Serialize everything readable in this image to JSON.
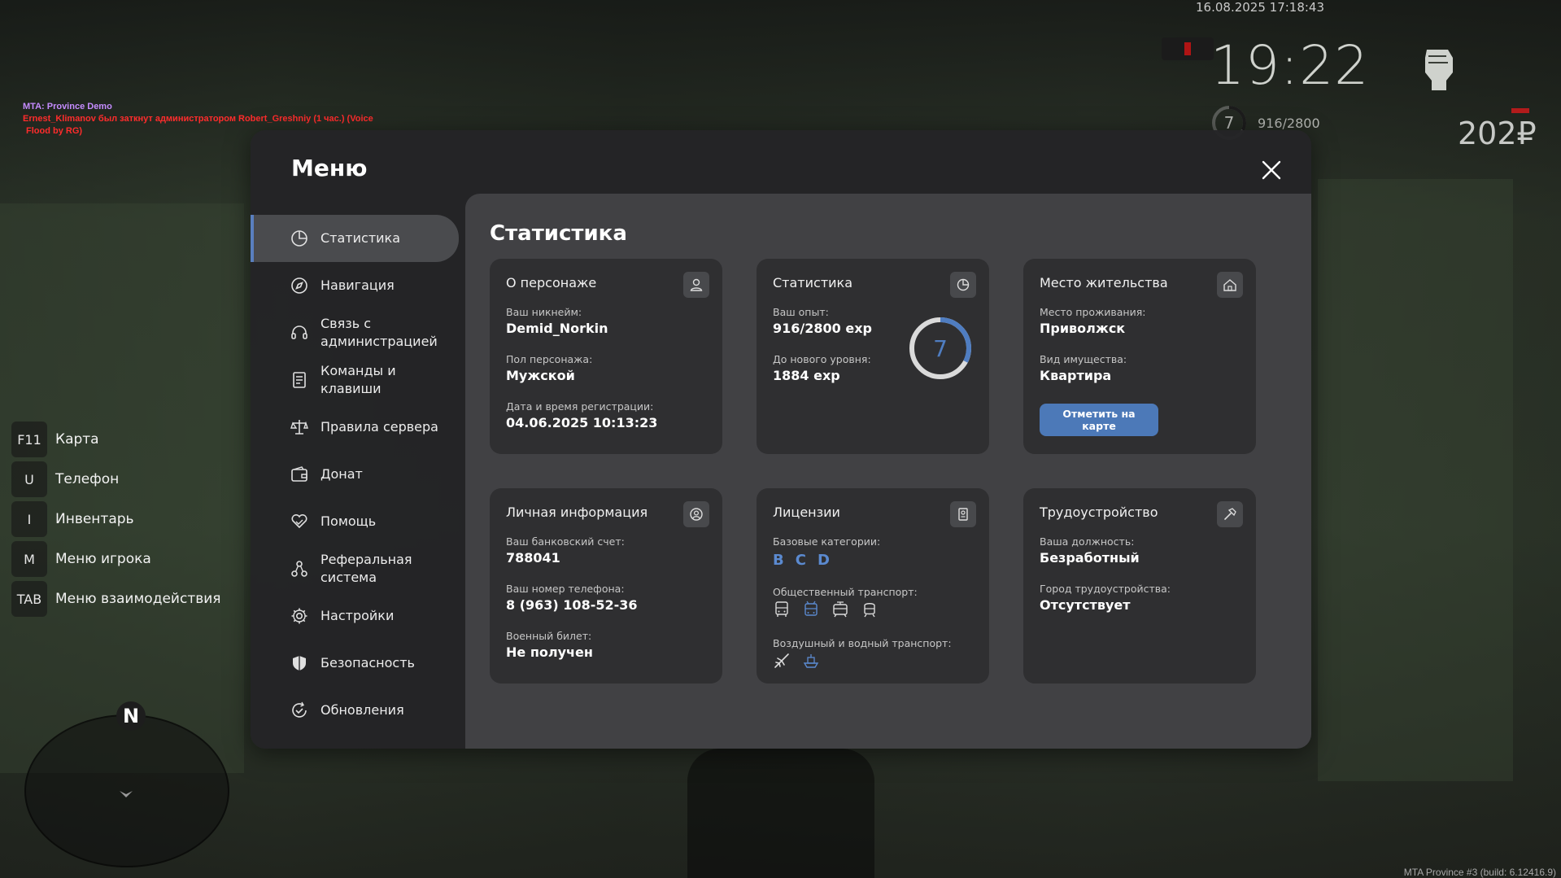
{
  "hud": {
    "date": "16.08.2025 17:18:43",
    "time": "19:22",
    "level": "7",
    "exp": "916/2800",
    "money": "202₽"
  },
  "chat": {
    "line1": "MTA: Province Demo",
    "line2": "Ernest_Klimanov был заткнут администратором Robert_Greshniy (1 час.) (Voice",
    "line3": "Flood by RG)"
  },
  "watermark": "MTA Province #3 (build: 6.12416.9)",
  "hotkeys": [
    {
      "key": "F11",
      "label": "Карта"
    },
    {
      "key": "U",
      "label": "Телефон"
    },
    {
      "key": "I",
      "label": "Инвентарь"
    },
    {
      "key": "M",
      "label": "Меню игрока"
    },
    {
      "key": "TAB",
      "label": "Меню взаимодействия"
    }
  ],
  "minimap": {
    "north": "N"
  },
  "menu": {
    "title": "Меню",
    "nav": [
      {
        "label": "Статистика",
        "icon": "pie-chart-icon"
      },
      {
        "label": "Навигация",
        "icon": "compass-icon"
      },
      {
        "label": "Связь с администрацией",
        "icon": "headset-icon"
      },
      {
        "label": "Команды и клавиши",
        "icon": "document-icon"
      },
      {
        "label": "Правила сервера",
        "icon": "scales-icon"
      },
      {
        "label": "Донат",
        "icon": "wallet-icon"
      },
      {
        "label": "Помощь",
        "icon": "heart-hands-icon"
      },
      {
        "label": "Реферальная система",
        "icon": "referral-icon"
      },
      {
        "label": "Настройки",
        "icon": "gear-icon"
      },
      {
        "label": "Безопасность",
        "icon": "shield-icon"
      },
      {
        "label": "Обновления",
        "icon": "refresh-check-icon"
      }
    ],
    "content_title": "Статистика",
    "cards": {
      "character": {
        "title": "О персонаже",
        "nick_label": "Ваш никнейм:",
        "nick": "Demid_Norkin",
        "gender_label": "Пол персонажа:",
        "gender": "Мужской",
        "reg_label": "Дата и время регистрации:",
        "reg": "04.06.2025 10:13:23"
      },
      "stats": {
        "title": "Статистика",
        "exp_label": "Ваш опыт:",
        "exp": "916/2800 exp",
        "next_label": "До нового уровня:",
        "next": "1884 exp",
        "level": "7",
        "progress": 0.327
      },
      "residence": {
        "title": "Место жительства",
        "place_label": "Место проживания:",
        "place": "Приволжск",
        "type_label": "Вид имущества:",
        "type": "Квартира",
        "button": "Отметить на карте"
      },
      "personal": {
        "title": "Личная информация",
        "bank_label": "Ваш банковский счет:",
        "bank": "788041",
        "phone_label": "Ваш номер телефона:",
        "phone": "8 (963) 108-52-36",
        "military_label": "Военный билет:",
        "military": "Не получен"
      },
      "licenses": {
        "title": "Лицензии",
        "base_label": "Базовые категории:",
        "base": [
          "B",
          "C",
          "D"
        ],
        "public_label": "Общественный транспорт:",
        "air_label": "Воздушный и водный транспорт:"
      },
      "employment": {
        "title": "Трудоустройство",
        "position_label": "Ваша должность:",
        "position": "Безработный",
        "city_label": "Город трудоустройства:",
        "city": "Отсутствует"
      }
    }
  },
  "colors": {
    "accent": "#5a7fbf",
    "button": "#4c79b8",
    "panel": "#2f2f31"
  }
}
